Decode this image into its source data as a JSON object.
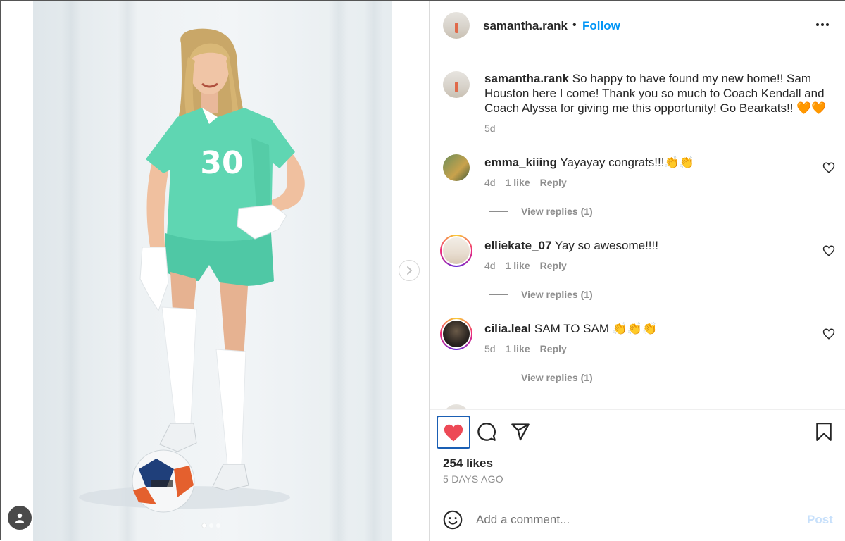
{
  "post": {
    "username": "samantha.rank",
    "separator": "•",
    "follow_label": "Follow",
    "caption": "So happy to have found my new home!! Sam Houston here I come! Thank you so much to Coach Kendall and Coach Alyssa for giving me this opportunity! Go Bearkats!! 🧡🧡",
    "caption_age": "5d",
    "jersey_number": "30",
    "carousel_dots": 3,
    "carousel_active_index": 0
  },
  "comments": [
    {
      "username": "emma_kiiing",
      "text": "Yayayay congrats!!!👏👏",
      "age": "4d",
      "likes": "1 like",
      "reply_label": "Reply",
      "view_replies": "View replies (1)",
      "story_ring": false
    },
    {
      "username": "elliekate_07",
      "text": "Yay so awesome!!!!",
      "age": "4d",
      "likes": "1 like",
      "reply_label": "Reply",
      "view_replies": "View replies (1)",
      "story_ring": true
    },
    {
      "username": "cilia.leal",
      "text": "SAM TO SAM 👏👏👏",
      "age": "5d",
      "likes": "1 like",
      "reply_label": "Reply",
      "view_replies": "View replies (1)",
      "story_ring": true
    }
  ],
  "actions": {
    "likes": "254 likes",
    "time_ago": "5 DAYS AGO",
    "liked": true,
    "like_color": "#ed4956"
  },
  "comment_box": {
    "placeholder": "Add a comment...",
    "value": "",
    "post_label": "Post"
  },
  "colors": {
    "accent": "#0095f6",
    "jersey": "#5fd6b2"
  }
}
